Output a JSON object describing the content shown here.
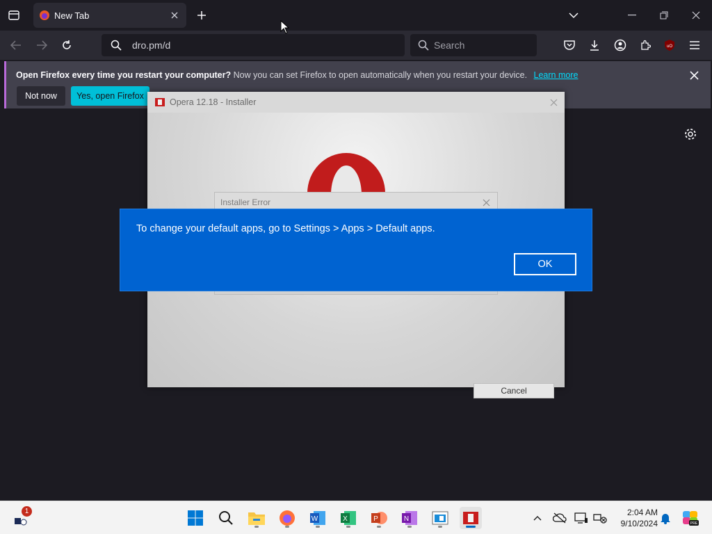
{
  "browser": {
    "tab": {
      "title": "New Tab"
    },
    "url": "dro.pm/d",
    "search_placeholder": "Search"
  },
  "notification": {
    "bold": "Open Firefox every time you restart your computer?",
    "text": "Now you can set Firefox to open automatically when you restart your device.",
    "link": "Learn more",
    "not_now": "Not now",
    "yes": "Yes, open Firefox"
  },
  "opera_installer": {
    "title": "Opera 12.18 - Installer",
    "cancel": "Cancel",
    "error_title": "Installer Error"
  },
  "default_apps_dialog": {
    "message": "To change your default apps, go to Settings > Apps > Default apps.",
    "ok": "OK"
  },
  "taskbar": {
    "notification_count": "1",
    "time": "2:04 AM",
    "date": "9/10/2024",
    "apps": [
      "start-icon",
      "search-icon",
      "file-explorer-icon",
      "firefox-icon",
      "word-icon",
      "excel-icon",
      "powerpoint-icon",
      "onenote-icon",
      "app-window-icon",
      "opera-installer-icon"
    ]
  },
  "colors": {
    "dialog_blue": "#0063d1",
    "firefox_accent": "#00bfd8",
    "opera_red": "#cc1b1b"
  }
}
